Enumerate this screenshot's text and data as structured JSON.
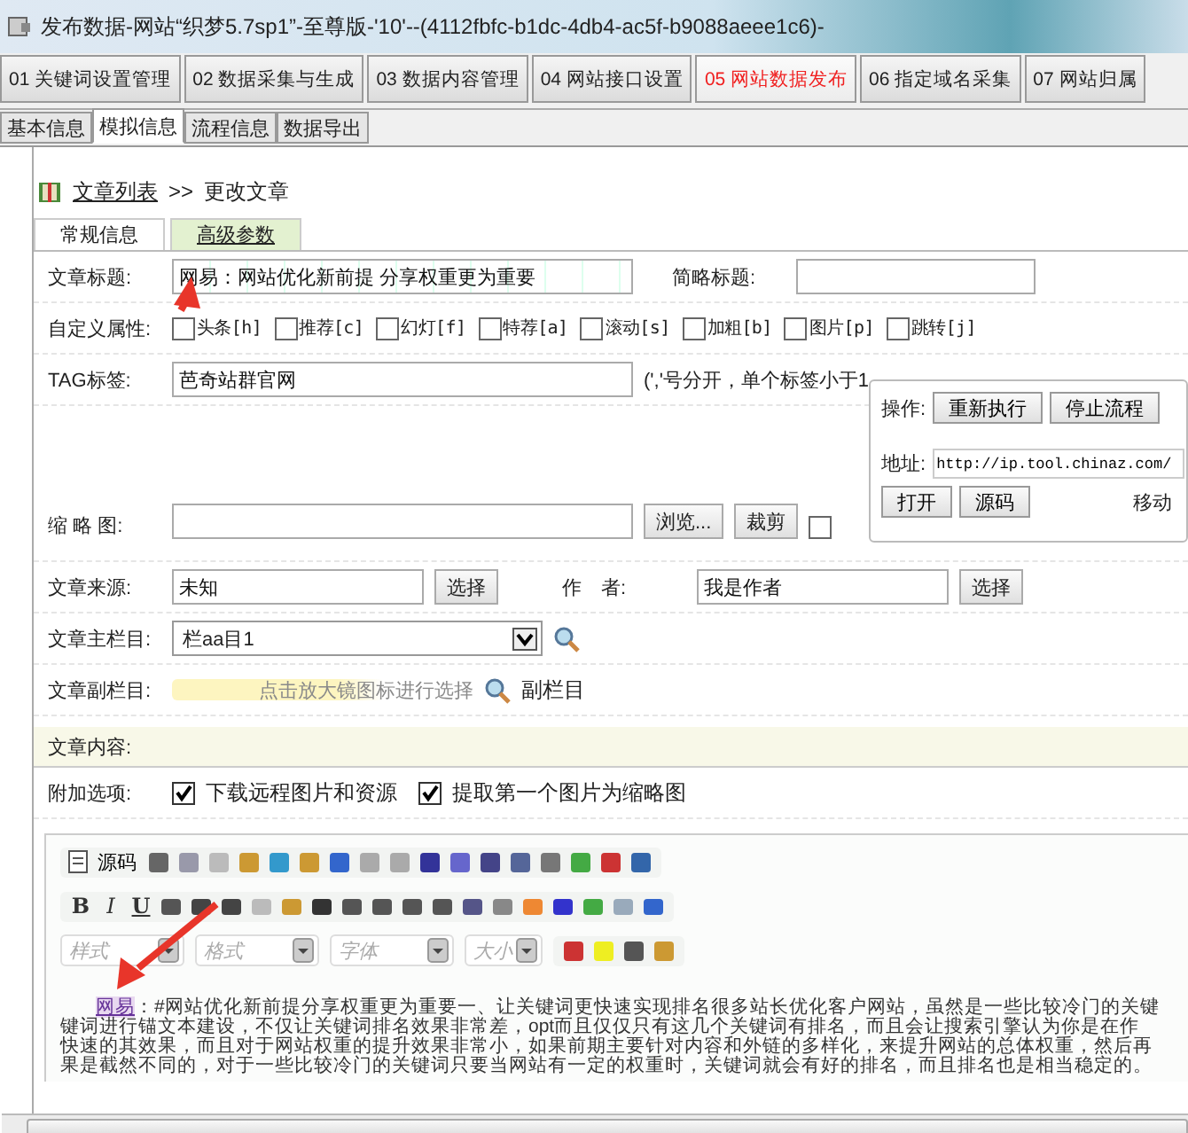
{
  "window": {
    "title": "发布数据-网站“织梦5.7sp1”-至尊版-'10'--(4112fbfc-b1dc-4db4-ac5f-b9088aeee1c6)-"
  },
  "main_tabs": [
    {
      "label": "01 关键词设置管理",
      "selected": false
    },
    {
      "label": "02 数据采集与生成",
      "selected": false
    },
    {
      "label": "03 数据内容管理",
      "selected": false
    },
    {
      "label": "04 网站接口设置",
      "selected": false
    },
    {
      "label": "05 网站数据发布",
      "selected": true
    },
    {
      "label": "06 指定域名采集",
      "selected": false
    },
    {
      "label": "07 网站归属",
      "selected": false
    }
  ],
  "sub_tabs": [
    {
      "label": "基本信息",
      "selected": false
    },
    {
      "label": "模拟信息",
      "selected": true
    },
    {
      "label": "流程信息",
      "selected": false
    },
    {
      "label": "数据导出",
      "selected": false
    }
  ],
  "breadcrumb": {
    "link": "文章列表",
    "separator": ">>",
    "current": "更改文章"
  },
  "form_tabs": [
    {
      "label": "常规信息",
      "selected": true
    },
    {
      "label": "高级参数",
      "selected": false
    }
  ],
  "form": {
    "title": {
      "label": "文章标题:",
      "value": "网易：网站优化新前提 分享权重更为重要"
    },
    "short_title": {
      "label": "简略标题:"
    },
    "attributes": {
      "label": "自定义属性:",
      "options": [
        {
          "label": "头条[h]",
          "checked": false
        },
        {
          "label": "推荐[c]",
          "checked": false
        },
        {
          "label": "幻灯[f]",
          "checked": false
        },
        {
          "label": "特荐[a]",
          "checked": false
        },
        {
          "label": "滚动[s]",
          "checked": false
        },
        {
          "label": "加粗[b]",
          "checked": false
        },
        {
          "label": "图片[p]",
          "checked": false
        },
        {
          "label": "跳转[j]",
          "checked": false
        }
      ]
    },
    "tags": {
      "label": "TAG标签:",
      "value": "芭奇站群官网",
      "hint": "(','号分开，单个标签小于1"
    },
    "thumbnail": {
      "label": "缩 略 图:",
      "browse": "浏览...",
      "crop": "裁剪",
      "checked": false
    },
    "source": {
      "label": "文章来源:",
      "value": "未知",
      "button": "选择"
    },
    "author": {
      "label": "作　者:",
      "value": "我是作者",
      "button": "选择"
    },
    "main_column": {
      "label": "文章主栏目:",
      "value": "栏aa目1"
    },
    "sub_column": {
      "label": "文章副栏目:",
      "placeholder": "点击放大镜图标进行选择",
      "link": "副栏目"
    },
    "content_label": "文章内容:",
    "extras": {
      "label": "附加选项:",
      "options": [
        {
          "label": "下载远程图片和资源",
          "checked": true
        },
        {
          "label": "提取第一个图片为缩略图",
          "checked": true
        }
      ]
    }
  },
  "editor": {
    "source_button": "源码",
    "format_buttons": [
      "B",
      "I",
      "U"
    ],
    "dropdowns": [
      "样式",
      "格式",
      "字体",
      "大小"
    ],
    "link_text": "网易",
    "lines": [
      "：#网站优化新前提分享权重更为重要一、让关键词更快速实现排名很多站长优化客户网站，虽然是一些比较冷门的关键",
      "键词进行锚文本建设，不仅让关键词排名效果非常差，opt而且仅仅只有这几个关键词有排名，而且会让搜索引擎认为你是在作",
      "快速的其效果，而且对于网站权重的提升效果非常小，如果前期主要针对内容和外链的多样化，来提升网站的总体权重，然后再",
      "果是截然不同的，对于一些比较冷门的关键词只要当网站有一定的权重时，关键词就会有好的排名，而且排名也是相当稳定的。"
    ]
  },
  "popup": {
    "action_label": "操作:",
    "action_buttons": [
      "重新执行",
      "停止流程"
    ],
    "address_label": "地址:",
    "address": "http://ip.tool.chinaz.com/",
    "address_buttons": [
      "打开",
      "源码"
    ],
    "cut_text": "移动"
  }
}
